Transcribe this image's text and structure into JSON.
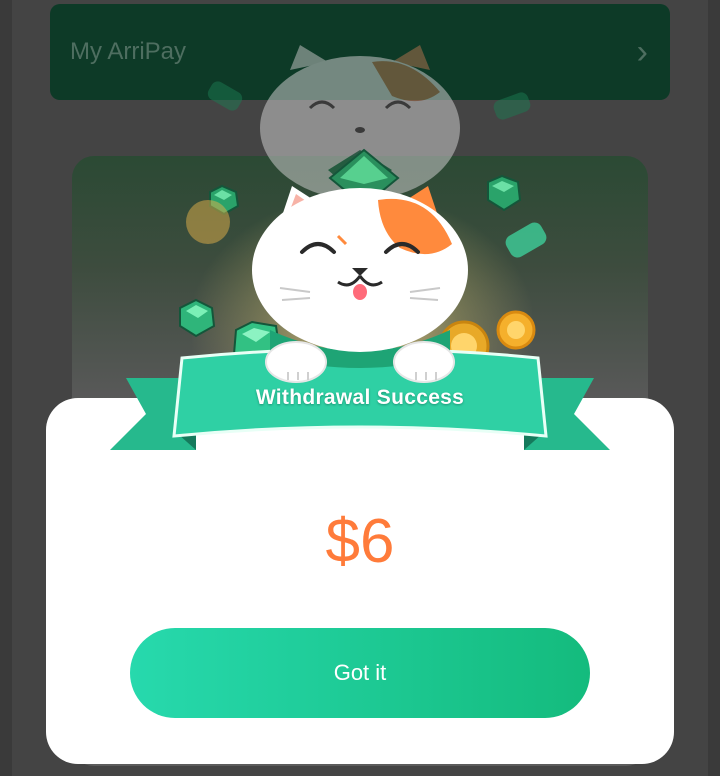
{
  "background": {
    "card_label": "My ArriPay",
    "chevron_icon": "chevron-right-icon"
  },
  "modal": {
    "title": "Withdrawal Success",
    "amount": "$6",
    "button_label": "Got it"
  },
  "colors": {
    "accent_green": "#1ec993",
    "amount_orange": "#ff7b3a",
    "ribbon_teal": "#2fd0a4"
  }
}
